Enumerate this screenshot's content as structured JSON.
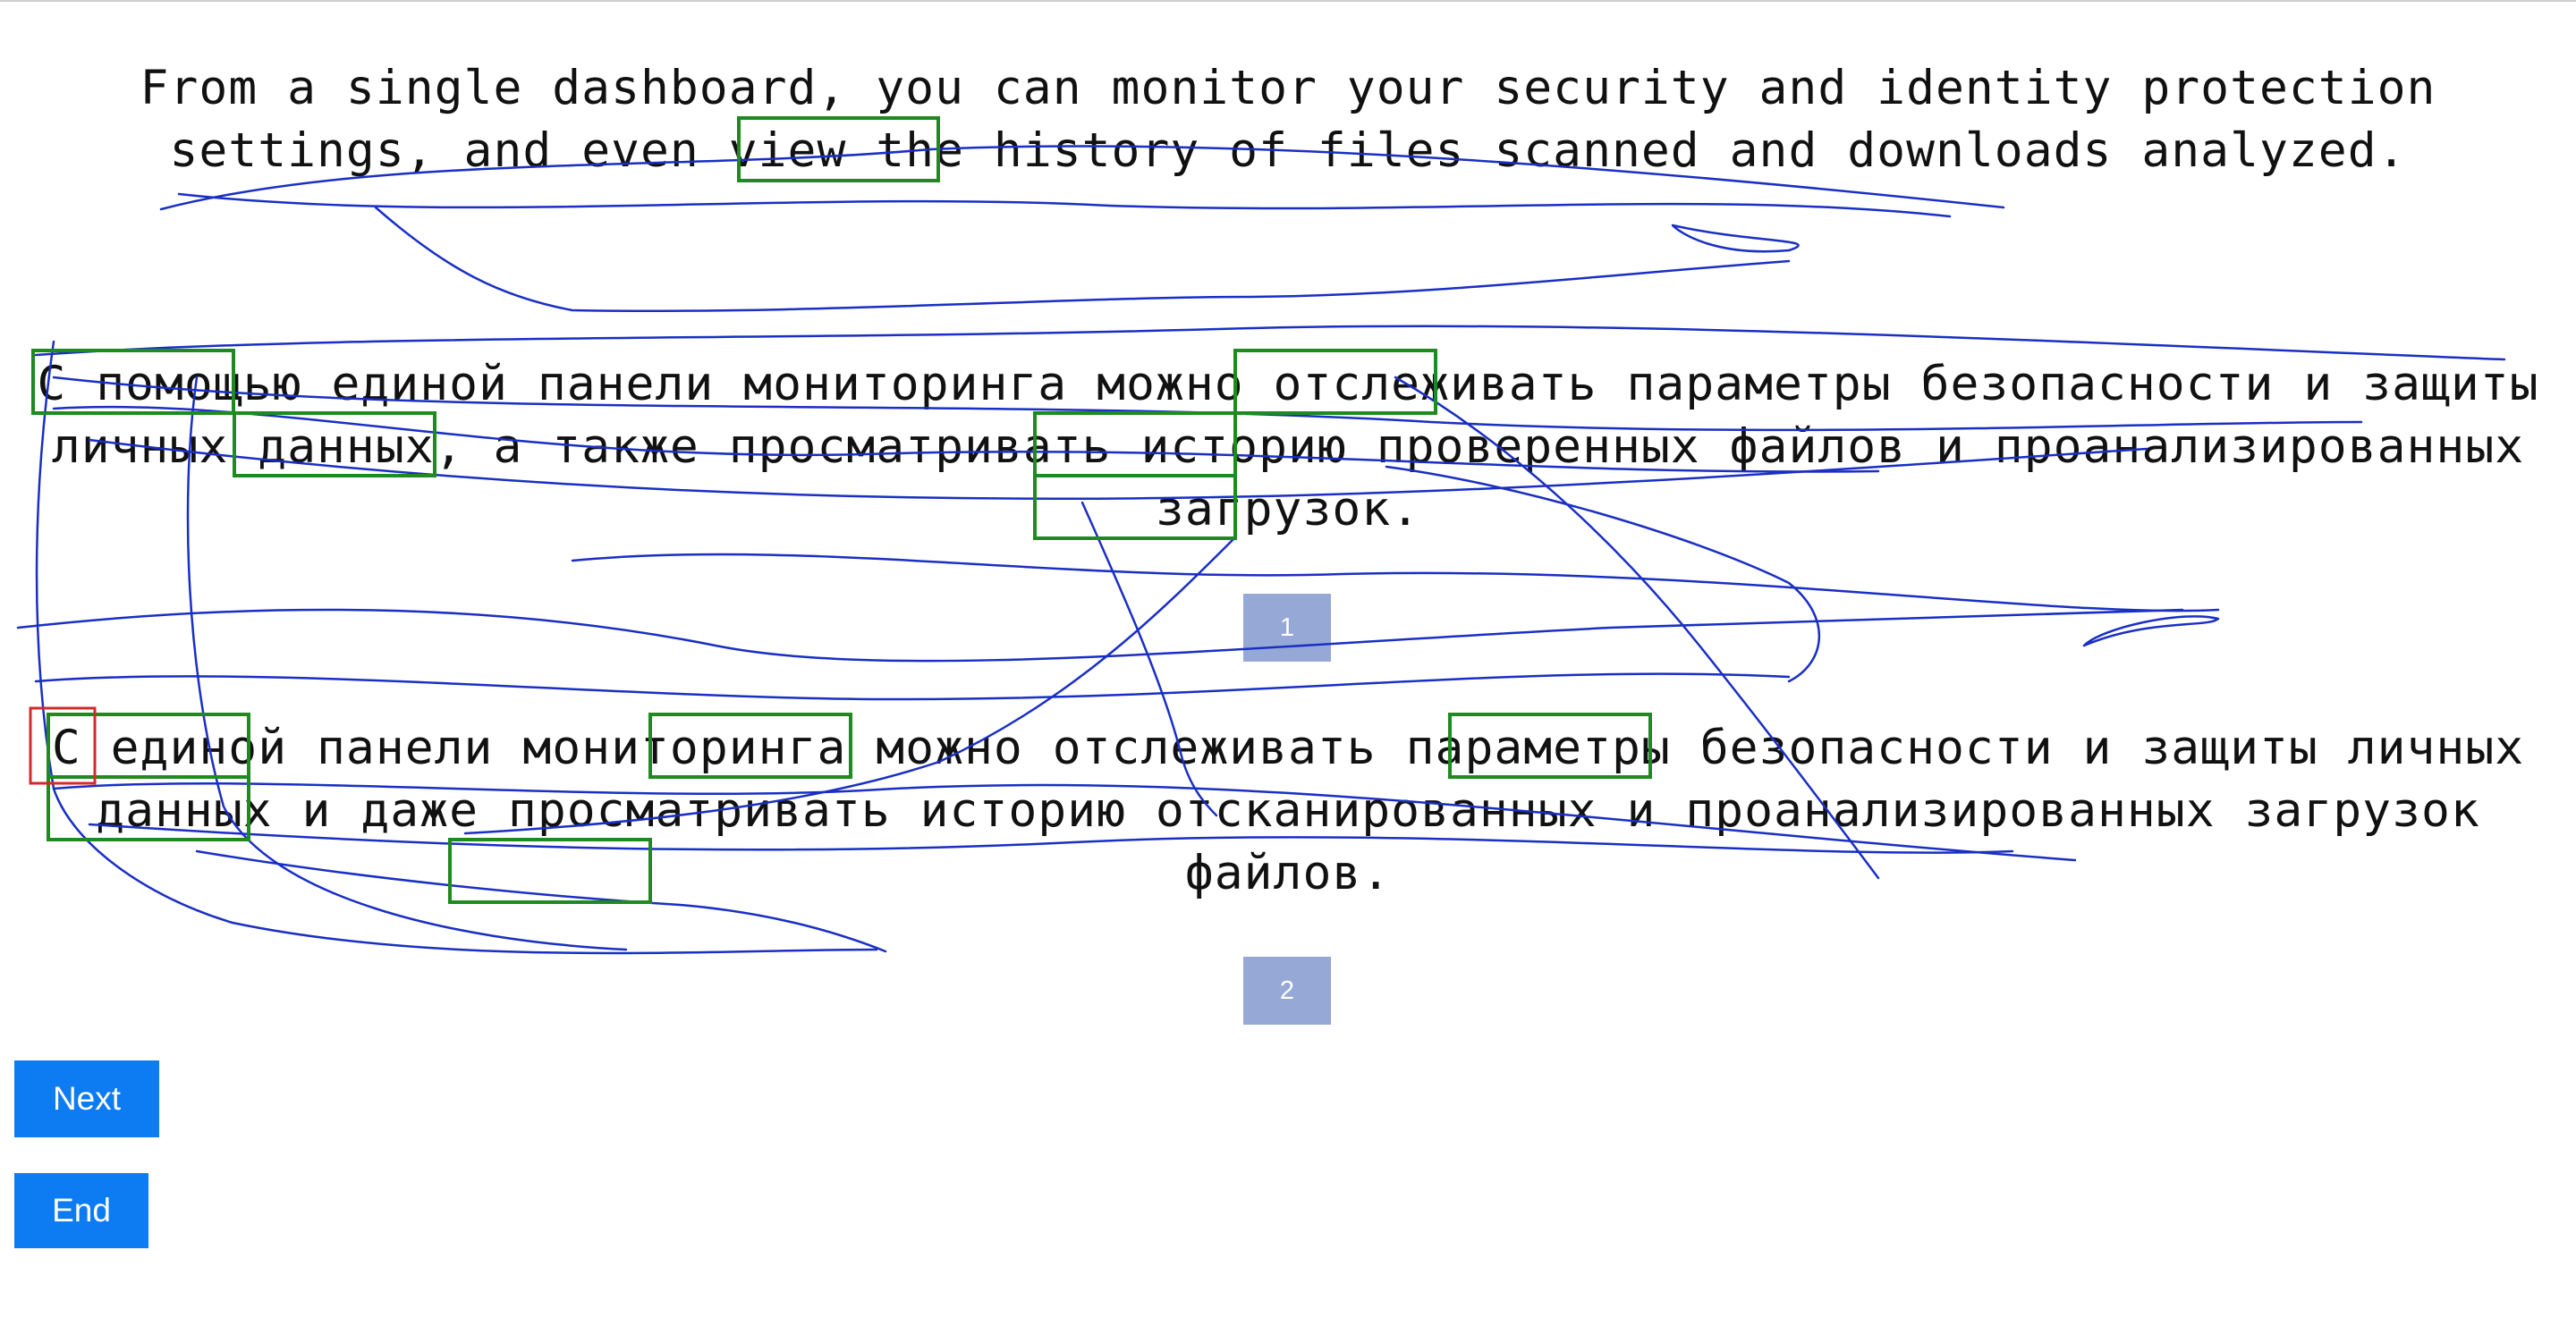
{
  "source_text": "From a single dashboard, you can monitor your security and identity protection settings, and even view the history of files scanned and downloads analyzed.",
  "translations": [
    {
      "text": "С помощью единой панели мониторинга можно отслеживать параметры безопасности и защиты личных данных, а также просматривать историю проверенных файлов и проанализированных загрузок.",
      "number": "1"
    },
    {
      "text": "С единой панели мониторинга можно отслеживать параметры безопасности и защиты личных данных и даже просматривать историю отсканированных и проанализированных загрузок файлов.",
      "number": "2"
    }
  ],
  "buttons": {
    "next_label": "Next",
    "end_label": "End"
  },
  "colors": {
    "scribble": "#1a2fc4",
    "highlight_box": "#1f8a1f",
    "cursor_box": "#d22b2b",
    "badge": "#96a8d6",
    "button": "#0d7bf2"
  }
}
